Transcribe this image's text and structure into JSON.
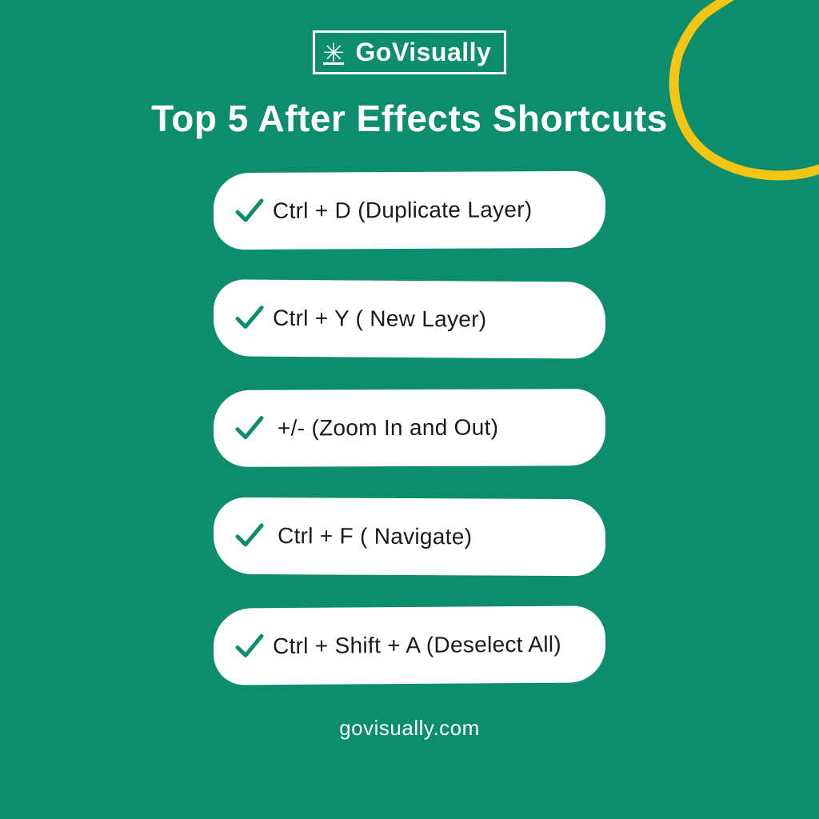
{
  "logo": {
    "text": "GoVisually"
  },
  "title": "Top 5 After Effects Shortcuts",
  "shortcuts": [
    "Ctrl + D (Duplicate Layer)",
    "Ctrl + Y ( New Layer)",
    "+/- (Zoom In and Out)",
    "Ctrl + F ( Navigate)",
    "Ctrl + Shift + A (Deselect All)"
  ],
  "footer": "govisually.com"
}
